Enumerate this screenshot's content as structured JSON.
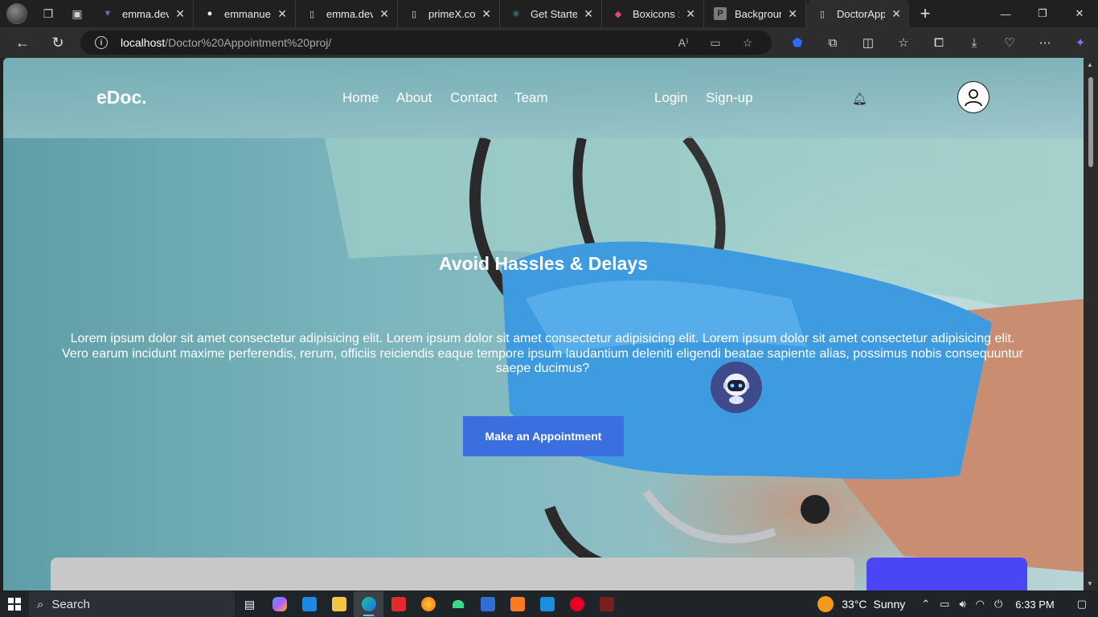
{
  "browser": {
    "tabs": [
      {
        "title": "emma.dev",
        "favicon": "v-logo-icon",
        "color": "#7b5cd6"
      },
      {
        "title": "emmanuel-n",
        "favicon": "github-icon",
        "color": "#ffffff"
      },
      {
        "title": "emma.dev",
        "favicon": "page-icon",
        "color": "#dddddd"
      },
      {
        "title": "primeX.com",
        "favicon": "page-icon",
        "color": "#dddddd"
      },
      {
        "title": "Get Started",
        "favicon": "react-icon",
        "color": "#5ac8e8"
      },
      {
        "title": "Boxicons : Pr",
        "favicon": "boxicons-icon",
        "color": "#e34c6c"
      },
      {
        "title": "Background",
        "favicon": "p-icon",
        "color": "#7a7a7a"
      },
      {
        "title": "DoctorAppo",
        "favicon": "page-icon",
        "color": "#dddddd"
      }
    ],
    "address": {
      "host": "localhost",
      "path": "/Doctor%20Appointment%20proj/"
    }
  },
  "site": {
    "logo": "eDoc.",
    "nav": {
      "home": "Home",
      "about": "About",
      "contact": "Contact",
      "team": "Team",
      "login": "Login",
      "signup": "Sign-up"
    },
    "hero": {
      "title": "Avoid Hassles & Delays",
      "text": "Lorem ipsum dolor sit amet consectetur adipisicing elit. Lorem ipsum dolor sit amet consectetur adipisicing elit. Lorem ipsum dolor sit amet consectetur adipisicing elit. Vero earum incidunt maxime perferendis, rerum, officiis reiciendis eaque tempore ipsum laudantium deleniti eligendi beatae sapiente alias, possimus nobis consequuntur saepe ducimus?",
      "cta": "Make an Appointment"
    },
    "accent_color": "#3b6fe0"
  },
  "taskbar": {
    "search_label": "Search",
    "weather": {
      "temp": "33°C",
      "condition": "Sunny"
    },
    "time": "6:33 PM"
  }
}
